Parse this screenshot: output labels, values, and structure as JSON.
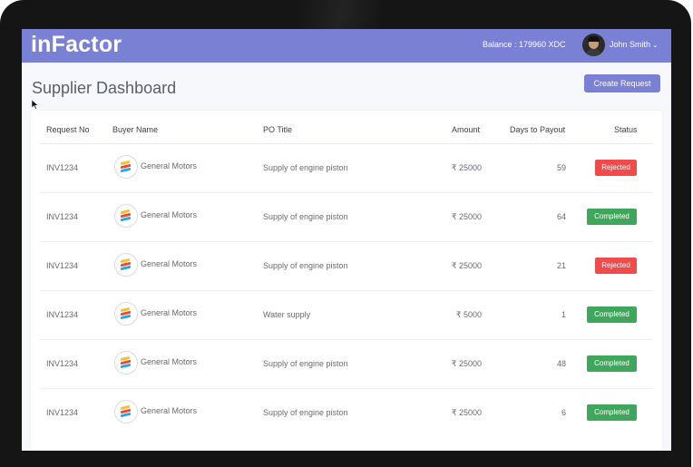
{
  "app": {
    "logo": "inFactor",
    "balance": "Balance : 179960 XDC",
    "user_name": "John Smith",
    "colors": {
      "accent": "#7a80d3",
      "rejected": "#ef4b4b",
      "completed": "#3fa75b"
    }
  },
  "page": {
    "title": "Supplier Dashboard",
    "create_button": "Create Request"
  },
  "table": {
    "headers": {
      "request_no": "Request No",
      "buyer_name": "Buyer Name",
      "po_title": "PO Title",
      "amount": "Amount",
      "days_to_payout": "Days to Payout",
      "status": "Status"
    },
    "rows": [
      {
        "request_no": "INV1234",
        "buyer": "General Motors",
        "po_title": "Supply of engine piston",
        "amount": "₹ 25000",
        "days": "59",
        "status": "Rejected"
      },
      {
        "request_no": "INV1234",
        "buyer": "General Motors",
        "po_title": "Supply of engine piston",
        "amount": "₹ 25000",
        "days": "64",
        "status": "Completed"
      },
      {
        "request_no": "INV1234",
        "buyer": "General Motors",
        "po_title": "Supply of engine piston",
        "amount": "₹ 25000",
        "days": "21",
        "status": "Rejected"
      },
      {
        "request_no": "INV1234",
        "buyer": "General Motors",
        "po_title": "Water supply",
        "amount": "₹ 5000",
        "days": "1",
        "status": "Completed"
      },
      {
        "request_no": "INV1234",
        "buyer": "General Motors",
        "po_title": "Supply of engine piston",
        "amount": "₹ 25000",
        "days": "48",
        "status": "Completed"
      },
      {
        "request_no": "INV1234",
        "buyer": "General Motors",
        "po_title": "Supply of engine piston",
        "amount": "₹ 25000",
        "days": "6",
        "status": "Completed"
      }
    ]
  },
  "icons": {
    "buyer_logo": "general-motors-logo",
    "avatar": "user-avatar",
    "dropdown": "chevron-down-icon"
  }
}
